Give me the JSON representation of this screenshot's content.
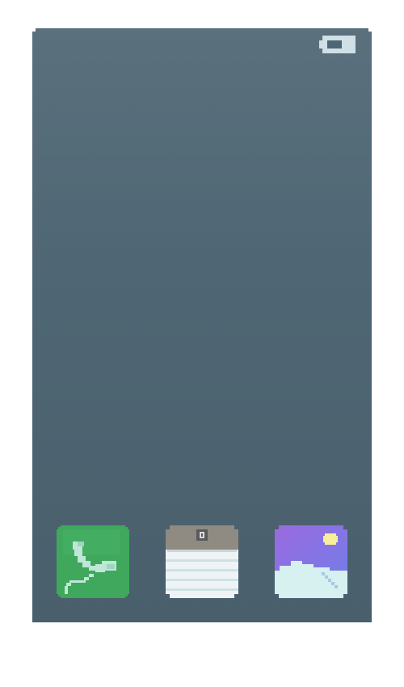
{
  "device": {
    "wallpaper_top": "#5a707d",
    "wallpaper_bottom": "#4a5f6c"
  },
  "status_bar": {
    "battery_icon": "battery-icon",
    "battery_color": "#cfe0e6"
  },
  "dock": {
    "apps": [
      {
        "id": "phone",
        "icon": "phone-app-icon",
        "color": "#3fa85c"
      },
      {
        "id": "notes",
        "icon": "notes-app-icon",
        "color": "#8f8b82"
      },
      {
        "id": "photos",
        "icon": "photos-app-icon",
        "color": "#8a63d8"
      }
    ]
  }
}
